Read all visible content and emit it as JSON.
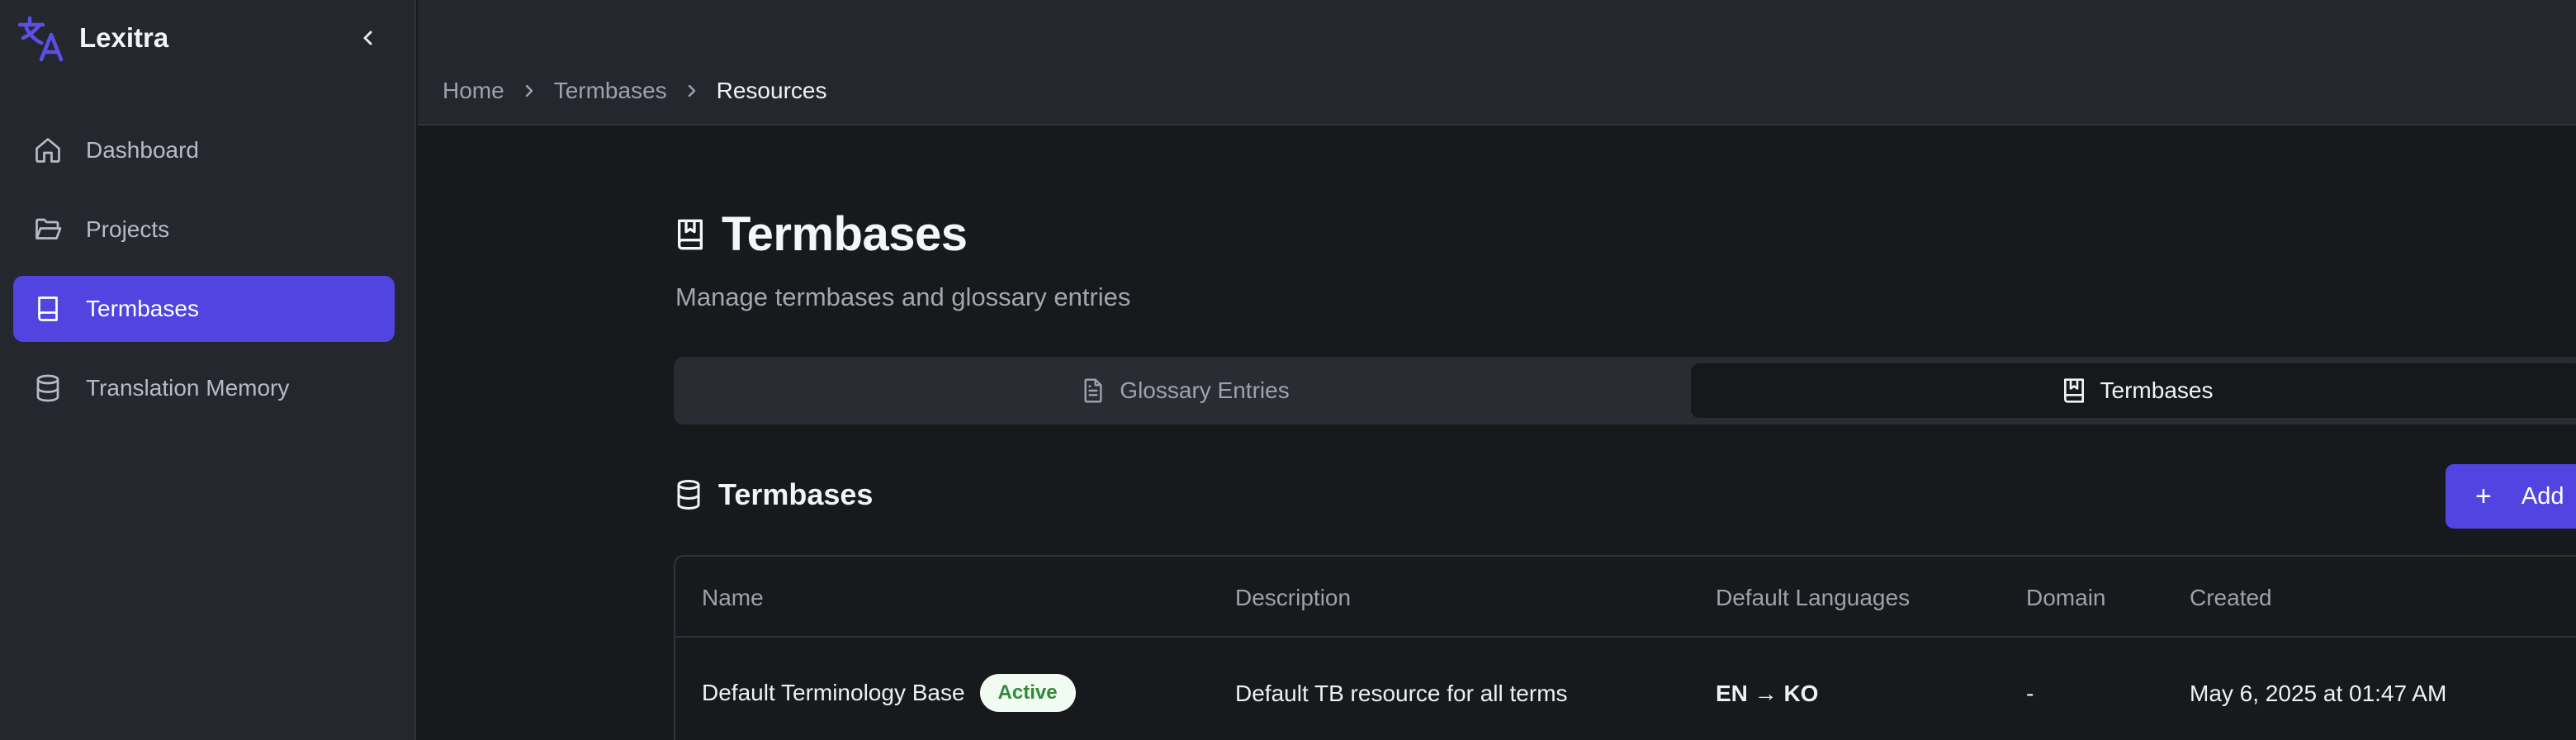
{
  "app": {
    "name": "Lexitra",
    "accent": "#5144e0"
  },
  "sidebar": {
    "items": [
      {
        "label": "Dashboard",
        "icon": "home-icon",
        "active": false
      },
      {
        "label": "Projects",
        "icon": "folder-open-icon",
        "active": false
      },
      {
        "label": "Termbases",
        "icon": "book-icon",
        "active": true
      },
      {
        "label": "Translation Memory",
        "icon": "database-icon",
        "active": false
      }
    ]
  },
  "breadcrumb": {
    "items": [
      "Home",
      "Termbases",
      "Resources"
    ]
  },
  "page": {
    "title": "Termbases",
    "subtitle": "Manage termbases and glossary entries"
  },
  "tabs": [
    {
      "label": "Glossary Entries",
      "icon": "file-text-icon",
      "active": false
    },
    {
      "label": "Termbases",
      "icon": "book-bookmark-icon",
      "active": true
    }
  ],
  "section": {
    "title": "Termbases",
    "icon": "database-icon",
    "add_label": "Add"
  },
  "table": {
    "columns": [
      "Name",
      "Description",
      "Default Languages",
      "Domain",
      "Created"
    ],
    "rows": [
      {
        "name": "Default Terminology Base",
        "status": "Active",
        "description": "Default TB resource for all terms",
        "languages": "EN → KO",
        "domain": "-",
        "created": "May 6, 2025 at 01:47 AM"
      }
    ]
  }
}
